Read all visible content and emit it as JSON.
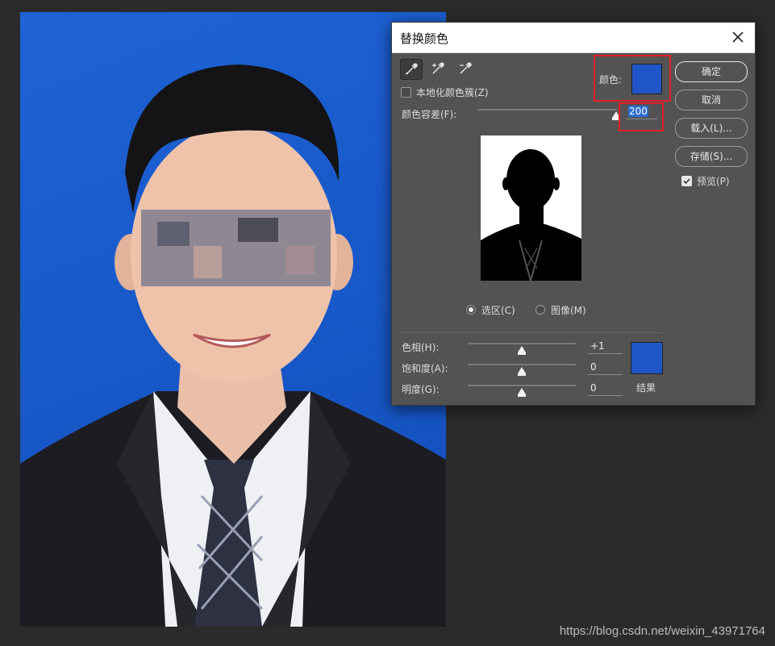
{
  "dialog": {
    "title": "替换颜色",
    "localized_clusters_label": "本地化颜色簇(Z)",
    "color_label": "颜色:",
    "fuzziness_label": "颜色容差(F):",
    "fuzziness_value": "200",
    "fuzziness_level": 1.0,
    "view_selection_label": "选区(C)",
    "view_image_label": "图像(M)",
    "view_selected": "selection",
    "hue_label": "色相(H):",
    "hue_value": "+1",
    "hue_level": 0.5,
    "saturation_label": "饱和度(A):",
    "saturation_value": "0",
    "saturation_level": 0.5,
    "lightness_label": "明度(G):",
    "lightness_value": "0",
    "lightness_level": 0.5,
    "result_label": "结果",
    "color_swatch": "#1f55c6",
    "result_swatch": "#1f55c6",
    "buttons": {
      "ok": "确定",
      "cancel": "取消",
      "load": "载入(L)...",
      "save": "存储(S)..."
    },
    "preview_label": "预览(P)",
    "preview_checked": true,
    "localized_checked": false,
    "tools": [
      "eyedropper-icon",
      "eyedropper-plus-icon",
      "eyedropper-minus-icon"
    ],
    "highlight_color": "#e0202a"
  },
  "background": {
    "photo_bg_color": "#1f63d6",
    "watermark": "https://blog.csdn.net/weixin_43971764"
  }
}
